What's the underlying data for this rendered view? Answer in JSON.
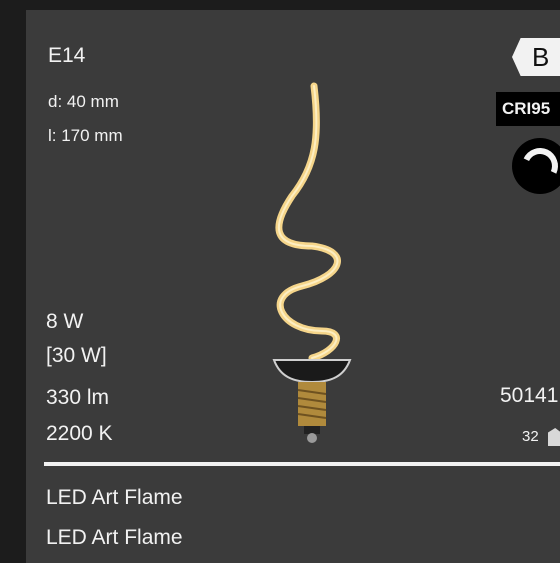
{
  "specs": {
    "socket": "E14",
    "diameter": "d: 40 mm",
    "length": "l:  170 mm",
    "wattage": "8 W",
    "wattage_equivalent": "[30 W]",
    "lumen": "330 lm",
    "color_temperature": "2200 K"
  },
  "badges": {
    "energy_class": "B",
    "cri": "CRI95",
    "dimmer_icon": "dimmable-icon"
  },
  "article_number": "50141",
  "pack_quantity": "32",
  "product_names": [
    "LED Art Flame",
    "LED Art Flame"
  ],
  "colors": {
    "background": "#3b3b3b",
    "text": "#f2f2f2",
    "filament": "#f5d58a",
    "base": "#b08a3c"
  }
}
